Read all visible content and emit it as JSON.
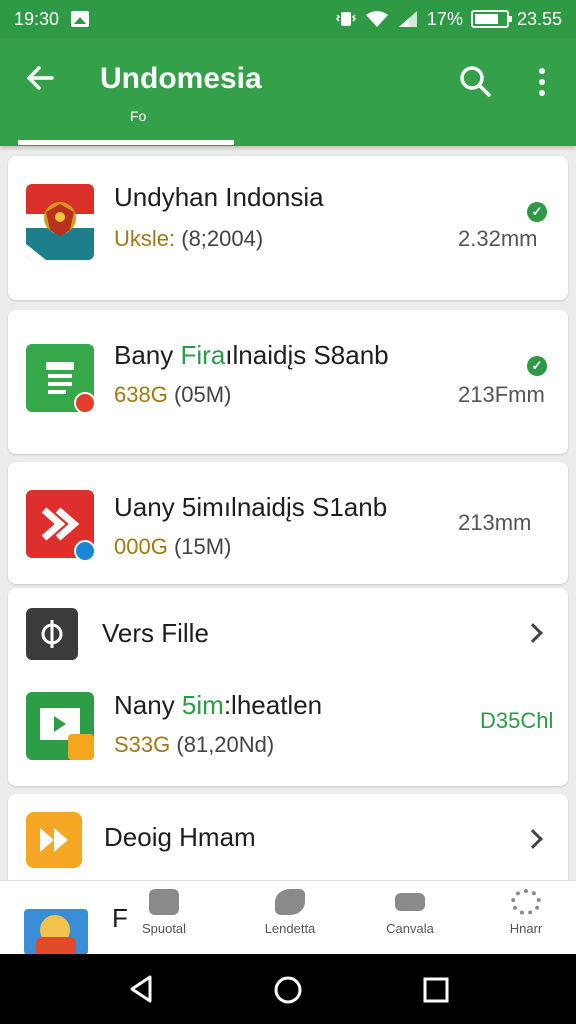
{
  "status": {
    "time": "19:30",
    "battery_percent": "17%",
    "clock_right": "23.55",
    "battery_level": 0.78
  },
  "appbar": {
    "back_icon": "arrow-left-icon",
    "title": "Undomesia",
    "subtitle": "Fo",
    "search_icon": "search-icon",
    "more_icon": "more-vert-icon"
  },
  "apps": [
    {
      "title": "Undyhan Indonsia",
      "price": "Uksle:",
      "size": "(8;2004)",
      "time": "2.32mm",
      "installed": true,
      "icon": "indonesia-emblem-icon"
    },
    {
      "title_a": "Bany ",
      "title_b": "Fira",
      "title_c": "ılnaidįs S8anb",
      "price": "638G",
      "size": "(05M)",
      "time": "213Fmm",
      "installed": true,
      "icon": "shopping-bag-icon"
    },
    {
      "title_a": "Uany 5im",
      "title_b": "ılnaidįs S1anb",
      "price": "000G",
      "size": "(15M)",
      "time": "213mm",
      "icon": "play-arrow-icon"
    }
  ],
  "section1": {
    "icon": "settings-link-icon",
    "title": "Vers Fille"
  },
  "app4": {
    "title_a": "Nany ",
    "title_b": "5im",
    "title_c": ":lheatlen",
    "price": "S33G",
    "size": "(81,20Nd)",
    "time": "D35Chl",
    "icon": "play-arrow-icon"
  },
  "section2": {
    "icon": "fast-forward-icon",
    "title": "Deoig Hmam"
  },
  "partial_row": {
    "letter": "F"
  },
  "bottom_nav": [
    {
      "label": "Spuotal",
      "icon": "bag-icon"
    },
    {
      "label": "Lendetta",
      "icon": "tag-icon"
    },
    {
      "label": "Canvala",
      "icon": "card-icon"
    },
    {
      "label": "Hnarr",
      "icon": "gear-icon"
    }
  ],
  "sys_nav": {
    "back": "back-triangle-icon",
    "home": "home-circle-icon",
    "recents": "recents-square-icon"
  }
}
